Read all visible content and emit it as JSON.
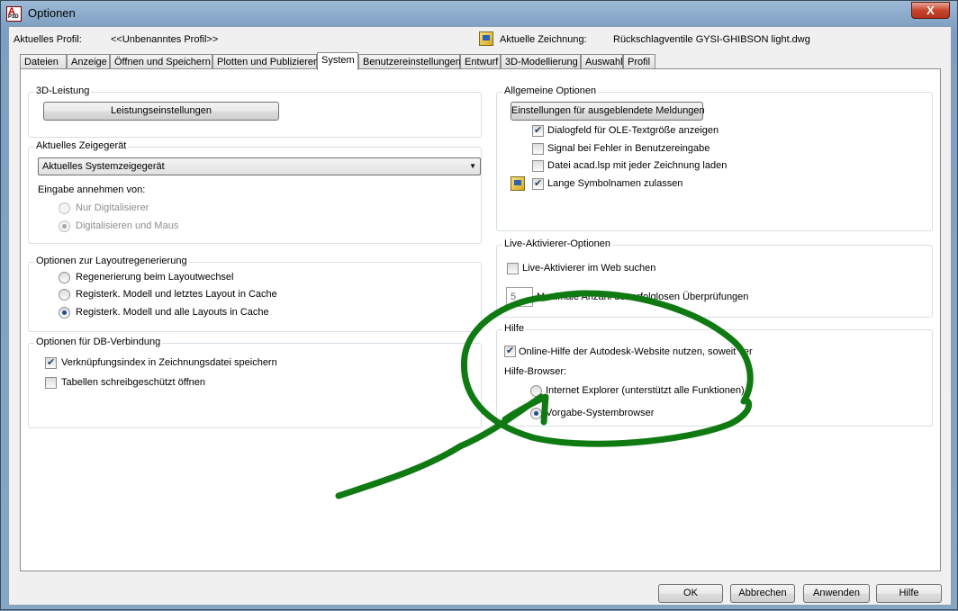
{
  "window": {
    "title": "Optionen",
    "app_icon_letter": "A",
    "app_icon_sub": "P3D",
    "close_label": "X"
  },
  "header": {
    "profile_label": "Aktuelles Profil:",
    "profile_value": "<<Unbenanntes Profil>>",
    "drawing_label": "Aktuelle Zeichnung:",
    "drawing_value": "Rückschlagventile GYSI-GHIBSON light.dwg"
  },
  "tabs": [
    "Dateien",
    "Anzeige",
    "Öffnen und Speichern",
    "Plotten und Publizieren",
    "System",
    "Benutzereinstellungen",
    "Entwurf",
    "3D-Modellierung",
    "Auswahl",
    "Profil"
  ],
  "active_tab": "System",
  "left": {
    "perf": {
      "title": "3D-Leistung",
      "button": "Leistungseinstellungen"
    },
    "pointer": {
      "title": "Aktuelles Zeigegerät",
      "selected": "Aktuelles Systemzeigegerät",
      "accept_label": "Eingabe annehmen von:",
      "opt1": "Nur Digitalisierer",
      "opt2": "Digitalisieren und Maus"
    },
    "layout": {
      "title": "Optionen zur Layoutregenerierung",
      "opt1": "Regenerierung beim Layoutwechsel",
      "opt2": "Registerk. Modell und letztes Layout in Cache",
      "opt3": "Registerk. Modell und alle Layouts in Cache"
    },
    "db": {
      "title": "Optionen für DB-Verbindung",
      "opt1": "Verknüpfungsindex in Zeichnungsdatei speichern",
      "opt2": "Tabellen schreibgeschützt öffnen"
    }
  },
  "right": {
    "general": {
      "title": "Allgemeine Optionen",
      "button": "Einstellungen für ausgeblendete Meldungen",
      "opt1": "Dialogfeld für OLE-Textgröße anzeigen",
      "opt2": "Signal bei Fehler in Benutzereingabe",
      "opt3": "Datei acad.lsp mit jeder Zeichnung laden",
      "opt4": "Lange Symbolnamen zulassen"
    },
    "live": {
      "title": "Live-Aktivierer-Optionen",
      "opt1": "Live-Aktivierer im Web suchen",
      "count_value": "5",
      "count_label": "Maximale Anzahl der erfolglosen Überprüfungen"
    },
    "help": {
      "title": "Hilfe",
      "online": "Online-Hilfe der Autodesk-Website nutzen, soweit ver",
      "browser_label": "Hilfe-Browser:",
      "opt1": "Internet Explorer (unterstützt alle Funktionen)",
      "opt2": "Vorgabe-Systembrowser"
    }
  },
  "footer": {
    "ok": "OK",
    "cancel": "Abbrechen",
    "apply": "Anwenden",
    "help": "Hilfe"
  },
  "colors": {
    "annotation": "#0f7a12",
    "panel_border": "#d5dfe5",
    "window_frame": "#86a6c6"
  }
}
